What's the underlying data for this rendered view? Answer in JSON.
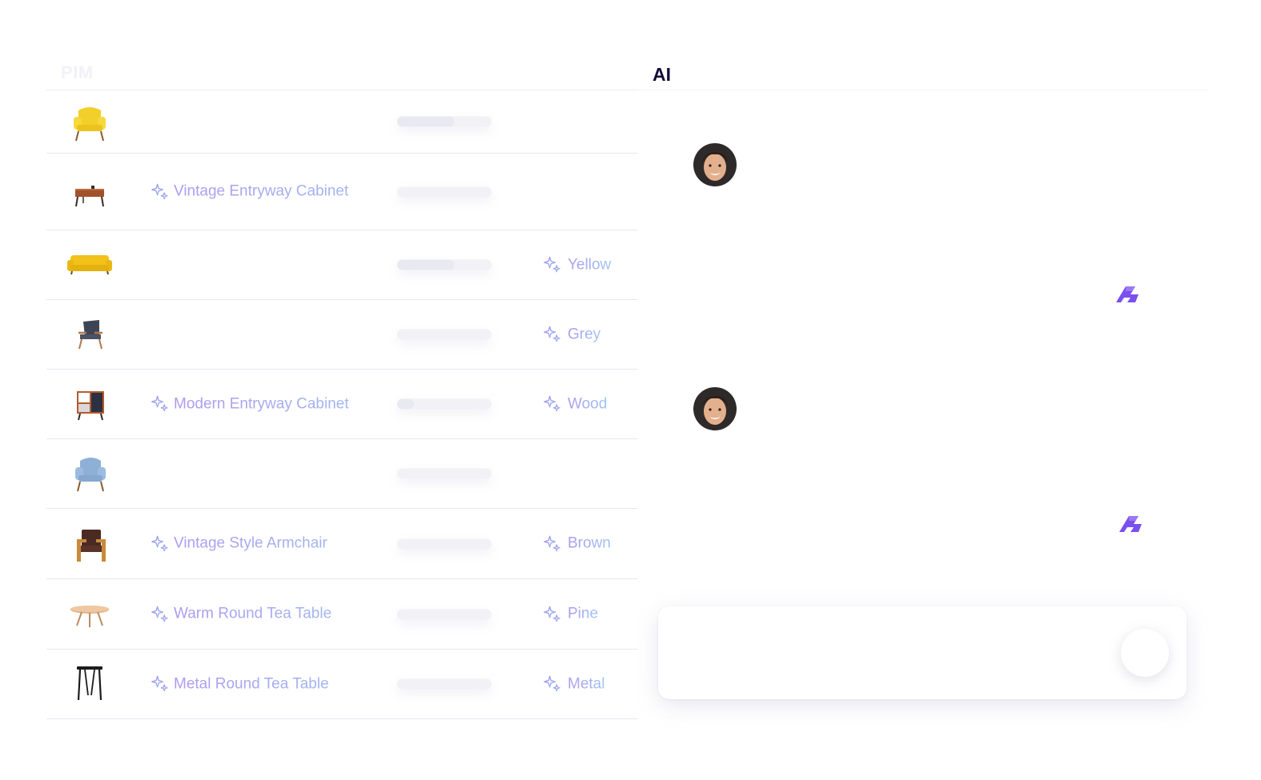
{
  "pim_panel": {
    "title": "PIM",
    "rows": [
      {
        "image": "yellow-armchair",
        "name": "",
        "progress": 0.6,
        "attribute": ""
      },
      {
        "image": "vintage-cabinet",
        "name": "Vintage Entryway Cabinet",
        "progress": 0.0,
        "attribute": ""
      },
      {
        "image": "yellow-sofa",
        "name": "",
        "progress": 0.6,
        "attribute": "Yellow"
      },
      {
        "image": "grey-armchair",
        "name": "",
        "progress": 0.0,
        "attribute": "Grey"
      },
      {
        "image": "modern-cabinet",
        "name": "Modern Entryway Cabinet",
        "progress": 0.18,
        "attribute": "Wood"
      },
      {
        "image": "blue-armchair",
        "name": "",
        "progress": 0.0,
        "attribute": ""
      },
      {
        "image": "brown-armchair",
        "name": "Vintage Style Armchair",
        "progress": 0.0,
        "attribute": "Brown"
      },
      {
        "image": "round-tea-table",
        "name": "Warm Round Tea Table",
        "progress": 0.0,
        "attribute": "Pine"
      },
      {
        "image": "metal-tea-table",
        "name": "Metal Round Tea Table",
        "progress": 0.0,
        "attribute": "Metal"
      }
    ]
  },
  "ai_panel": {
    "title": "AI",
    "messages": [
      {
        "sender": "user",
        "icon": "user-avatar"
      },
      {
        "sender": "assistant",
        "icon": "brand-logo-icon"
      },
      {
        "sender": "user",
        "icon": "user-avatar"
      },
      {
        "sender": "assistant",
        "icon": "brand-logo-icon"
      }
    ],
    "composer": {
      "send_icon": "send-button"
    }
  },
  "colors": {
    "accent_purple": "#7a4ff0",
    "ai_text_gradient_start": "#ad9af0",
    "ai_text_gradient_end": "#9fc4f2",
    "title_dark": "#140a3a"
  }
}
